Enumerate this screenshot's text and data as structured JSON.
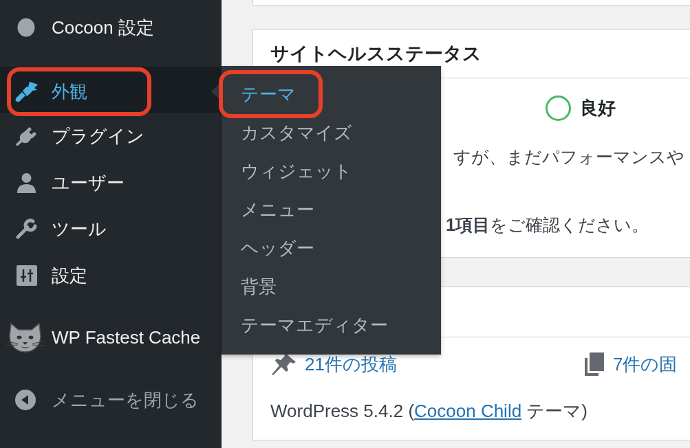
{
  "sidebar": {
    "sections": [
      {
        "items": [
          {
            "label": "Cocoon 設定",
            "selected": false,
            "highlighted": false
          }
        ]
      },
      {
        "items": [
          {
            "label": "外観",
            "selected": true,
            "highlighted": true,
            "submenu": [
              {
                "label": "テーマ",
                "selected": true,
                "highlighted": true
              },
              {
                "label": "カスタマイズ",
                "selected": false,
                "highlighted": false
              },
              {
                "label": "ウィジェット",
                "selected": false,
                "highlighted": false
              },
              {
                "label": "メニュー",
                "selected": false,
                "highlighted": false
              },
              {
                "label": "ヘッダー",
                "selected": false,
                "highlighted": false
              },
              {
                "label": "背景",
                "selected": false,
                "highlighted": false
              },
              {
                "label": "テーマエディター",
                "selected": false,
                "highlighted": false
              }
            ]
          },
          {
            "label": "プラグイン",
            "selected": false,
            "highlighted": false
          },
          {
            "label": "ユーザー",
            "selected": false,
            "highlighted": false
          },
          {
            "label": "ツール",
            "selected": false,
            "highlighted": false
          },
          {
            "label": "設定",
            "selected": false,
            "highlighted": false
          }
        ]
      },
      {
        "items": [
          {
            "label": "WP Fastest Cache",
            "selected": false,
            "highlighted": false
          }
        ]
      }
    ],
    "collapse_button": {
      "label": "メニューを閉じる"
    }
  },
  "site_health": {
    "title": "サイトヘルスステータス",
    "status": "良好",
    "lines": [
      "すが、まだパフォーマンスや",
      "**1項目**をご確認ください。"
    ]
  },
  "at_a_glance": {
    "links": [
      {
        "label": "21件の投稿"
      },
      {
        "label": "7件の固"
      }
    ],
    "version": {
      "text_before": "WordPress 5.4.2 (",
      "link": "Cocoon Child",
      "text_after": " テーマ)"
    }
  }
}
